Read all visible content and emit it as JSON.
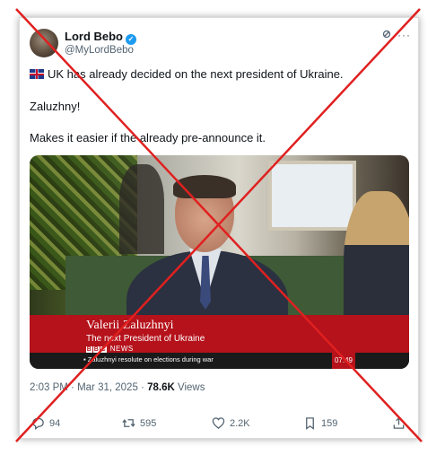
{
  "tweet": {
    "display_name": "Lord Bebo",
    "handle": "@MyLordBebo",
    "line1": "UK has already decided on the next president of Ukraine.",
    "line2": "Zaluzhny!",
    "line3": "Makes it easier if the already pre-announce it.",
    "icons": {
      "verified": "verified-badge-icon",
      "flag": "uk-flag-icon",
      "grok": "grok-icon",
      "more": "more-icon"
    }
  },
  "media": {
    "lower_third_name": "Valerii Zaluzhnyi",
    "lower_third_title": "The next President of Ukraine",
    "bbc_letters": [
      "B",
      "B",
      "C"
    ],
    "news_label": "NEWS",
    "ticker": "Zaluzhnyi resolute on elections during war",
    "time": "07:49"
  },
  "meta": {
    "time": "2:03 PM",
    "separator": "·",
    "date": "Mar 31, 2025",
    "views_count": "78.6K",
    "views_label": "Views"
  },
  "actions": {
    "replies": "94",
    "reposts": "595",
    "likes": "2.2K",
    "bookmarks": "159"
  },
  "overlay": {
    "cross_color": "#e02020"
  }
}
